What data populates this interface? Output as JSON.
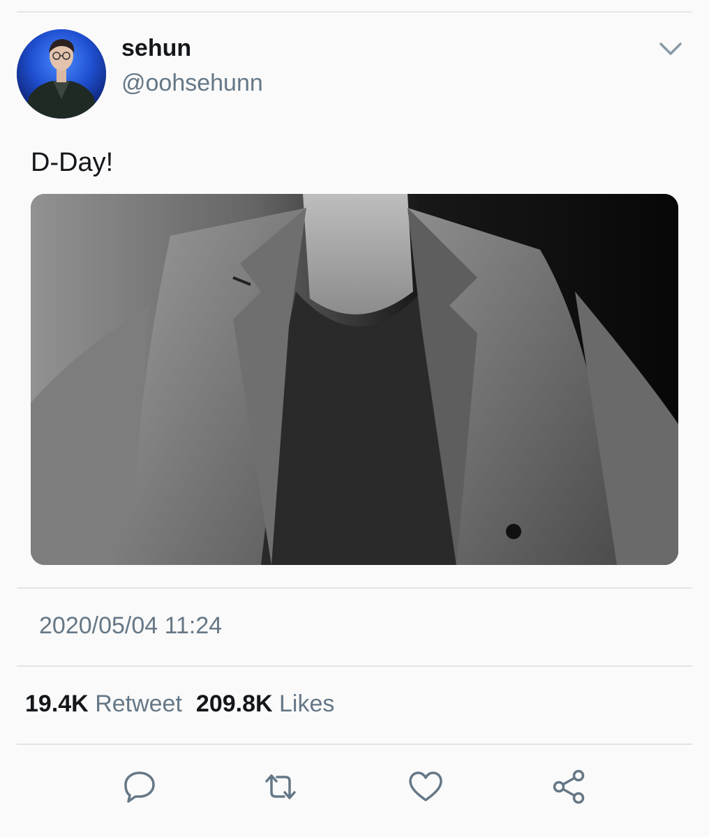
{
  "tweet": {
    "author_name": "sehun",
    "author_handle": "@oohsehunn",
    "text": "D-Day!",
    "timestamp": "2020/05/04 11:24",
    "retweet_count": "19.4K",
    "retweet_label": "Retweet",
    "like_count": "209.8K",
    "like_label": "Likes"
  },
  "icons": {
    "menu": "chevron-down-icon",
    "reply": "reply-icon",
    "retweet": "retweet-icon",
    "like": "heart-icon",
    "share": "share-icon"
  },
  "colors": {
    "secondary_text": "#657786",
    "icon": "#657786",
    "divider": "#e1e4e6",
    "background": "#fafafa"
  }
}
